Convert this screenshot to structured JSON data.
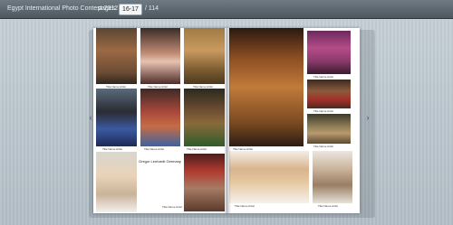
{
  "header": {
    "app_title": "Egypt International Photo Contest 2012",
    "pages_label": "pages:",
    "current_pages": "16-17",
    "total_pages": "/ 114"
  },
  "nav": {
    "prev_icon": "‹",
    "next_icon": "›"
  },
  "left_page": {
    "captions": [
      "Title  Name Artist",
      "Title  Name Artist",
      "Title  Name Artist",
      "Title  Name Artist",
      "Title  Name Artist",
      "Title  Name Artist"
    ],
    "note": "Gregor Lenhardt Germany",
    "note_small": "Title  Name Artist"
  },
  "right_page": {
    "captions": [
      "Title  Name Artist",
      "Title  Name Artist",
      "Title  Name Artist",
      "Title  Name Artist",
      "Title  Name Artist",
      "Title  Name Artist"
    ]
  }
}
